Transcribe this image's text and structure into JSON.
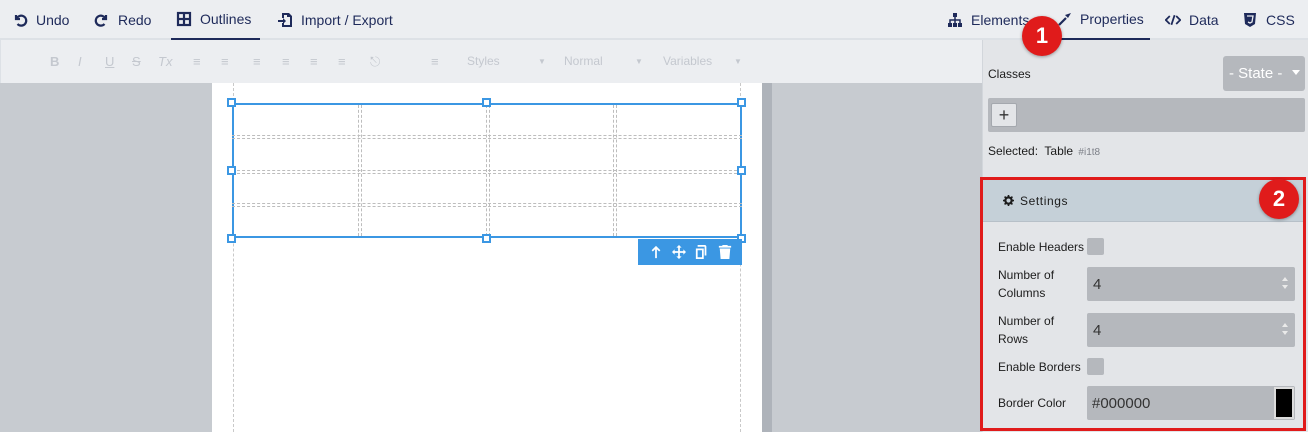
{
  "toolbar": {
    "undo": "Undo",
    "redo": "Redo",
    "outlines": "Outlines",
    "import_export": "Import / Export",
    "elements": "Elements",
    "properties": "Properties",
    "data": "Data",
    "css": "CSS"
  },
  "rte": {
    "bold": "B",
    "italic": "I",
    "underline": "U",
    "strike": "S",
    "clear": "Tx",
    "styles": "Styles",
    "normal": "Normal",
    "variables": "Variables"
  },
  "panel": {
    "classes_label": "Classes",
    "state_label": "- State -",
    "add_class": "+",
    "selected_label": "Selected:",
    "selected_name": "Table",
    "selected_id": "#i1t8"
  },
  "settings": {
    "title": "Settings",
    "enable_headers": "Enable Headers",
    "num_columns_label": "Number of Columns",
    "num_columns_value": "4",
    "num_rows_label": "Number of Rows",
    "num_rows_value": "4",
    "enable_borders": "Enable Borders",
    "border_color_label": "Border Color",
    "border_color_value": "#000000"
  },
  "badges": {
    "one": "1",
    "two": "2"
  },
  "colors": {
    "accent": "#3b97e3",
    "highlight": "#e01b1b",
    "text": "#1e2a5a"
  }
}
